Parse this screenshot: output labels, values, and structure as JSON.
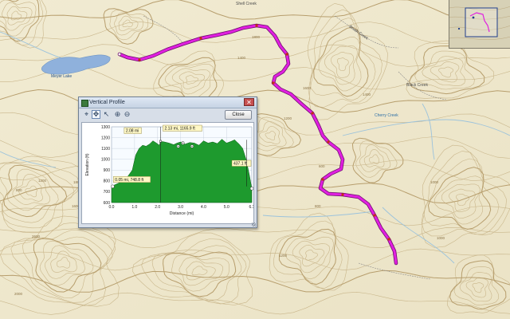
{
  "map": {
    "lake_label": "Meyer Lake",
    "road_label_1": "Shell Creek",
    "road_label_2": "Brush Creek",
    "road_label_3": "Black Creek",
    "stream_label": "Cherry Creek",
    "contour_labels": [
      "1800",
      "1400",
      "1200",
      "1600",
      "2600",
      "1200",
      "800",
      "1000",
      "600",
      "800",
      "2000",
      "1800",
      "1200",
      "1800",
      "1600",
      "1000",
      "1200",
      "1400"
    ],
    "track_color": "#e020e0",
    "track_marker_color": "#c73010"
  },
  "overview": {
    "frame_color": "#1f3d8a"
  },
  "profile_window": {
    "title": "Vertical Profile",
    "close_label": "Close",
    "close_x": "✕",
    "tools": [
      "target-icon",
      "pan-icon",
      "select-icon",
      "zoom-in-icon",
      "zoom-out-icon"
    ],
    "active_tool": "pan-icon"
  },
  "chart_data": {
    "type": "area",
    "xlabel": "Distance   (mi)",
    "ylabel": "Elevation (ft)",
    "xlim": [
      0,
      6.1
    ],
    "ylim": [
      600,
      1300
    ],
    "x_ticks": [
      "0.0",
      "1.0",
      "2.0",
      "3.0",
      "4.0",
      "5.0",
      "6.1"
    ],
    "y_ticks": [
      "600",
      "700",
      "800",
      "900",
      "1000",
      "1100",
      "1200",
      "1300"
    ],
    "grid": true,
    "fill_color": "#1e9a2e",
    "series": [
      {
        "x": [
          0,
          0.1,
          0.3,
          0.5,
          0.7,
          0.9,
          1.05,
          1.2,
          1.35,
          1.5,
          1.65,
          1.8,
          1.95,
          2.08,
          2.13,
          2.3,
          2.5,
          2.7,
          2.85,
          3.0,
          3.2,
          3.4,
          3.6,
          3.8,
          4.0,
          4.2,
          4.4,
          4.6,
          4.8,
          5.0,
          5.2,
          5.35,
          5.45,
          5.55,
          5.7,
          5.85,
          6.0,
          6.1
        ],
        "y": [
          749,
          760,
          780,
          800,
          840,
          900,
          1040,
          1100,
          1130,
          1120,
          1140,
          1170,
          1150,
          1130,
          1166,
          1160,
          1150,
          1135,
          1150,
          1160,
          1140,
          1155,
          1150,
          1130,
          1170,
          1150,
          1160,
          1145,
          1185,
          1150,
          1165,
          1180,
          1160,
          1140,
          1100,
          1000,
          850,
          730
        ]
      }
    ],
    "annotations": [
      {
        "label": "2.08 mi",
        "x": 2.08
      },
      {
        "label": "2.13 mi, 1165.9 ft",
        "x": 2.13,
        "y": 1165.9
      },
      {
        "label": "0.05 mi, 748.8 ft",
        "x": 0.05,
        "y": 748.8
      },
      {
        "label": "437.1 ft"
      }
    ]
  }
}
